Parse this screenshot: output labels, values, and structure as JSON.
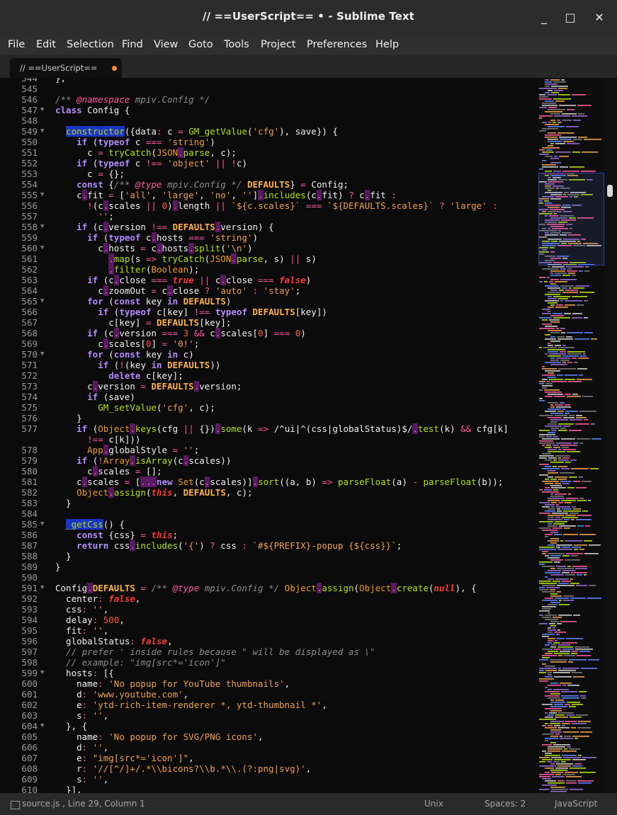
{
  "window": {
    "title": "// ==UserScript== • - Sublime Text",
    "minimize": "_",
    "maximize": "□",
    "close": "✕"
  },
  "menu": [
    "File",
    "Edit",
    "Selection",
    "Find",
    "View",
    "Goto",
    "Tools",
    "Project",
    "Preferences",
    "Help"
  ],
  "tab": {
    "label": "// ==UserScript=="
  },
  "status": {
    "file": "source.js , Line 29, Column 1",
    "line_ending": "Unix",
    "spaces": "Spaces: 2",
    "syntax": "JavaScript"
  },
  "colors": {
    "default": "#f1f1f1",
    "comment": "#8c8c8c",
    "keyword": "#b48cff",
    "string": "#f0a04b",
    "func": "#b4e10f",
    "builtin": "#f09a1f",
    "constant": "#ff3b30",
    "number": "#ff5b3b",
    "operator": "#ff5aa0",
    "selection": "#1a33c8",
    "orange": "#ffb347"
  },
  "code": {
    "lines": [
      {
        "n": "544",
        "t": "};",
        "fold": false
      },
      {
        "n": "545",
        "t": "",
        "fold": false
      },
      {
        "n": "546",
        "t": "/** @namespace mpiv.Config */",
        "fold": false
      },
      {
        "n": "547",
        "t": "class Config {",
        "fold": true
      },
      {
        "n": "548",
        "t": "",
        "fold": false
      },
      {
        "n": "549",
        "t": "  constructor({data: c = GM_getValue('cfg'), save}) {",
        "fold": true
      },
      {
        "n": "550",
        "t": "    if (typeof c === 'string')",
        "fold": false
      },
      {
        "n": "551",
        "t": "      c = tryCatch(JSON.parse, c);",
        "fold": false
      },
      {
        "n": "552",
        "t": "    if (typeof c !== 'object' || !c)",
        "fold": false
      },
      {
        "n": "553",
        "t": "      c = {};",
        "fold": false
      },
      {
        "n": "554",
        "t": "    const {/** @type mpiv.Config */ DEFAULTS} = Config;",
        "fold": false
      },
      {
        "n": "555",
        "t": "    c.fit = ['all', 'large', 'no', ''].includes(c.fit) ? c.fit :",
        "fold": true
      },
      {
        "n": "556",
        "t": "      !(c.scales || 0).length || `${c.scales}` === `${DEFAULTS.scales}` ? 'large' :",
        "fold": false
      },
      {
        "n": "557",
        "t": "        '';",
        "fold": false
      },
      {
        "n": "558",
        "t": "    if (c.version !== DEFAULTS.version) {",
        "fold": true
      },
      {
        "n": "559",
        "t": "      if (typeof c.hosts === 'string')",
        "fold": false
      },
      {
        "n": "560",
        "t": "        c.hosts = c.hosts.split('\\n')",
        "fold": true
      },
      {
        "n": "561",
        "t": "          .map(s => tryCatch(JSON.parse, s) || s)",
        "fold": false
      },
      {
        "n": "562",
        "t": "          .filter(Boolean);",
        "fold": false
      },
      {
        "n": "563",
        "t": "      if (c.close === true || c.close === false)",
        "fold": false
      },
      {
        "n": "564",
        "t": "        c.zoomOut = c.close ? 'auto' : 'stay';",
        "fold": false
      },
      {
        "n": "565",
        "t": "      for (const key in DEFAULTS)",
        "fold": true
      },
      {
        "n": "566",
        "t": "        if (typeof c[key] !== typeof DEFAULTS[key])",
        "fold": false
      },
      {
        "n": "567",
        "t": "          c[key] = DEFAULTS[key];",
        "fold": false
      },
      {
        "n": "568",
        "t": "      if (c.version === 3 && c.scales[0] === 0)",
        "fold": false
      },
      {
        "n": "569",
        "t": "        c.scales[0] = '0!';",
        "fold": false
      },
      {
        "n": "570",
        "t": "      for (const key in c)",
        "fold": true
      },
      {
        "n": "571",
        "t": "        if (!(key in DEFAULTS))",
        "fold": false
      },
      {
        "n": "572",
        "t": "          delete c[key];",
        "fold": false
      },
      {
        "n": "573",
        "t": "      c.version = DEFAULTS.version;",
        "fold": false
      },
      {
        "n": "574",
        "t": "      if (save)",
        "fold": false
      },
      {
        "n": "575",
        "t": "        GM_setValue('cfg', c);",
        "fold": false
      },
      {
        "n": "576",
        "t": "    }",
        "fold": false
      },
      {
        "n": "577",
        "t": "    if (Object.keys(cfg || {}).some(k => /^ui|^(css|globalStatus)$/.test(k) && cfg[k]",
        "fold": false
      },
      {
        "n": "",
        "t": "      !== c[k]))",
        "fold": false
      },
      {
        "n": "578",
        "t": "      App.globalStyle = '';",
        "fold": false
      },
      {
        "n": "579",
        "t": "    if (!Array.isArray(c.scales))",
        "fold": false
      },
      {
        "n": "580",
        "t": "      c.scales = [];",
        "fold": false
      },
      {
        "n": "581",
        "t": "    c.scales = [...new Set(c.scales)].sort((a, b) => parseFloat(a) - parseFloat(b));",
        "fold": false
      },
      {
        "n": "582",
        "t": "    Object.assign(this, DEFAULTS, c);",
        "fold": false
      },
      {
        "n": "583",
        "t": "  }",
        "fold": false
      },
      {
        "n": "584",
        "t": "",
        "fold": false
      },
      {
        "n": "585",
        "t": "  _getCss() {",
        "fold": true
      },
      {
        "n": "586",
        "t": "    const {css} = this;",
        "fold": false
      },
      {
        "n": "587",
        "t": "    return css.includes('{') ? css : `#${PREFIX}-popup {${css}}`;",
        "fold": false
      },
      {
        "n": "588",
        "t": "  }",
        "fold": false
      },
      {
        "n": "589",
        "t": "}",
        "fold": false
      },
      {
        "n": "590",
        "t": "",
        "fold": false
      },
      {
        "n": "591",
        "t": "Config.DEFAULTS = /** @type mpiv.Config */ Object.assign(Object.create(null), {",
        "fold": true
      },
      {
        "n": "592",
        "t": "  center: false,",
        "fold": false
      },
      {
        "n": "593",
        "t": "  css: '',",
        "fold": false
      },
      {
        "n": "594",
        "t": "  delay: 500,",
        "fold": false
      },
      {
        "n": "595",
        "t": "  fit: '',",
        "fold": false
      },
      {
        "n": "596",
        "t": "  globalStatus: false,",
        "fold": false
      },
      {
        "n": "597",
        "t": "  // prefer ' inside rules because \" will be displayed as \\\"",
        "fold": false
      },
      {
        "n": "598",
        "t": "  // example: \"img[src*='icon']\"",
        "fold": false
      },
      {
        "n": "599",
        "t": "  hosts: [{",
        "fold": true
      },
      {
        "n": "600",
        "t": "    name: 'No popup for YouTube thumbnails',",
        "fold": false
      },
      {
        "n": "601",
        "t": "    d: 'www.youtube.com',",
        "fold": false
      },
      {
        "n": "602",
        "t": "    e: 'ytd-rich-item-renderer *, ytd-thumbnail *',",
        "fold": false
      },
      {
        "n": "603",
        "t": "    s: '',",
        "fold": false
      },
      {
        "n": "604",
        "t": "  }, {",
        "fold": true
      },
      {
        "n": "605",
        "t": "    name: 'No popup for SVG/PNG icons',",
        "fold": false
      },
      {
        "n": "606",
        "t": "    d: '',",
        "fold": false
      },
      {
        "n": "607",
        "t": "    e: \"img[src*='icon']\",",
        "fold": false
      },
      {
        "n": "608",
        "t": "    r: '//[^/]+/.*\\\\bicons?\\\\b.*\\\\.(?:png|svg)',",
        "fold": false
      },
      {
        "n": "609",
        "t": "    s: '',",
        "fold": false
      },
      {
        "n": "610",
        "t": "  }],",
        "fold": false
      }
    ]
  }
}
